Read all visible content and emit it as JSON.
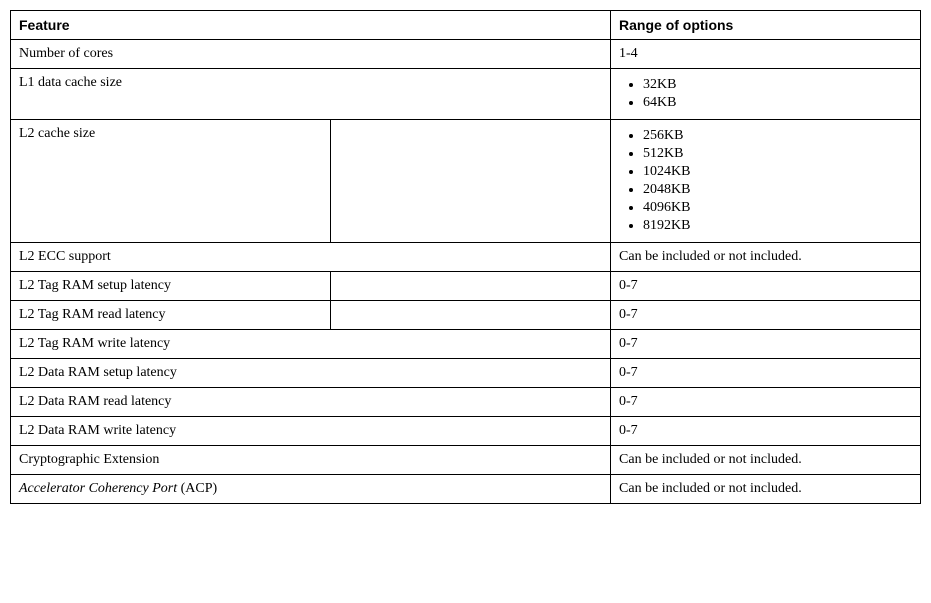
{
  "headers": {
    "feature": "Feature",
    "options": "Range of options"
  },
  "rows": [
    {
      "feature_plain": "Number of cores",
      "options_plain": "1-4",
      "feature_span2": true
    },
    {
      "feature_plain": "L1 data cache size",
      "options_list": [
        "32KB",
        "64KB"
      ],
      "feature_span2": true
    },
    {
      "feature_plain": "L2 cache size",
      "options_list": [
        "256KB",
        "512KB",
        "1024KB",
        "2048KB",
        "4096KB",
        "8192KB"
      ],
      "feature_span2": false
    },
    {
      "feature_plain": "L2 ECC support",
      "options_plain": "Can be included or not included.",
      "feature_span2": true
    },
    {
      "feature_plain": "L2 Tag RAM setup latency",
      "options_plain": "0-7",
      "feature_span2": false
    },
    {
      "feature_plain": "L2 Tag RAM read latency",
      "options_plain": "0-7",
      "feature_span2": false
    },
    {
      "feature_plain": "L2 Tag RAM write latency",
      "options_plain": "0-7",
      "feature_span2": true
    },
    {
      "feature_plain": "L2 Data RAM setup latency",
      "options_plain": "0-7",
      "feature_span2": true
    },
    {
      "feature_plain": "L2 Data RAM read latency",
      "options_plain": "0-7",
      "feature_span2": true
    },
    {
      "feature_plain": "L2 Data RAM write latency",
      "options_plain": "0-7",
      "feature_span2": true
    },
    {
      "feature_plain": "Cryptographic Extension",
      "options_plain": "Can be included or not included.",
      "feature_span2": true
    },
    {
      "feature_italic": "Accelerator Coherency Port",
      "feature_suffix": " (ACP)",
      "options_plain": "Can be included or not included.",
      "feature_span2": true
    }
  ]
}
